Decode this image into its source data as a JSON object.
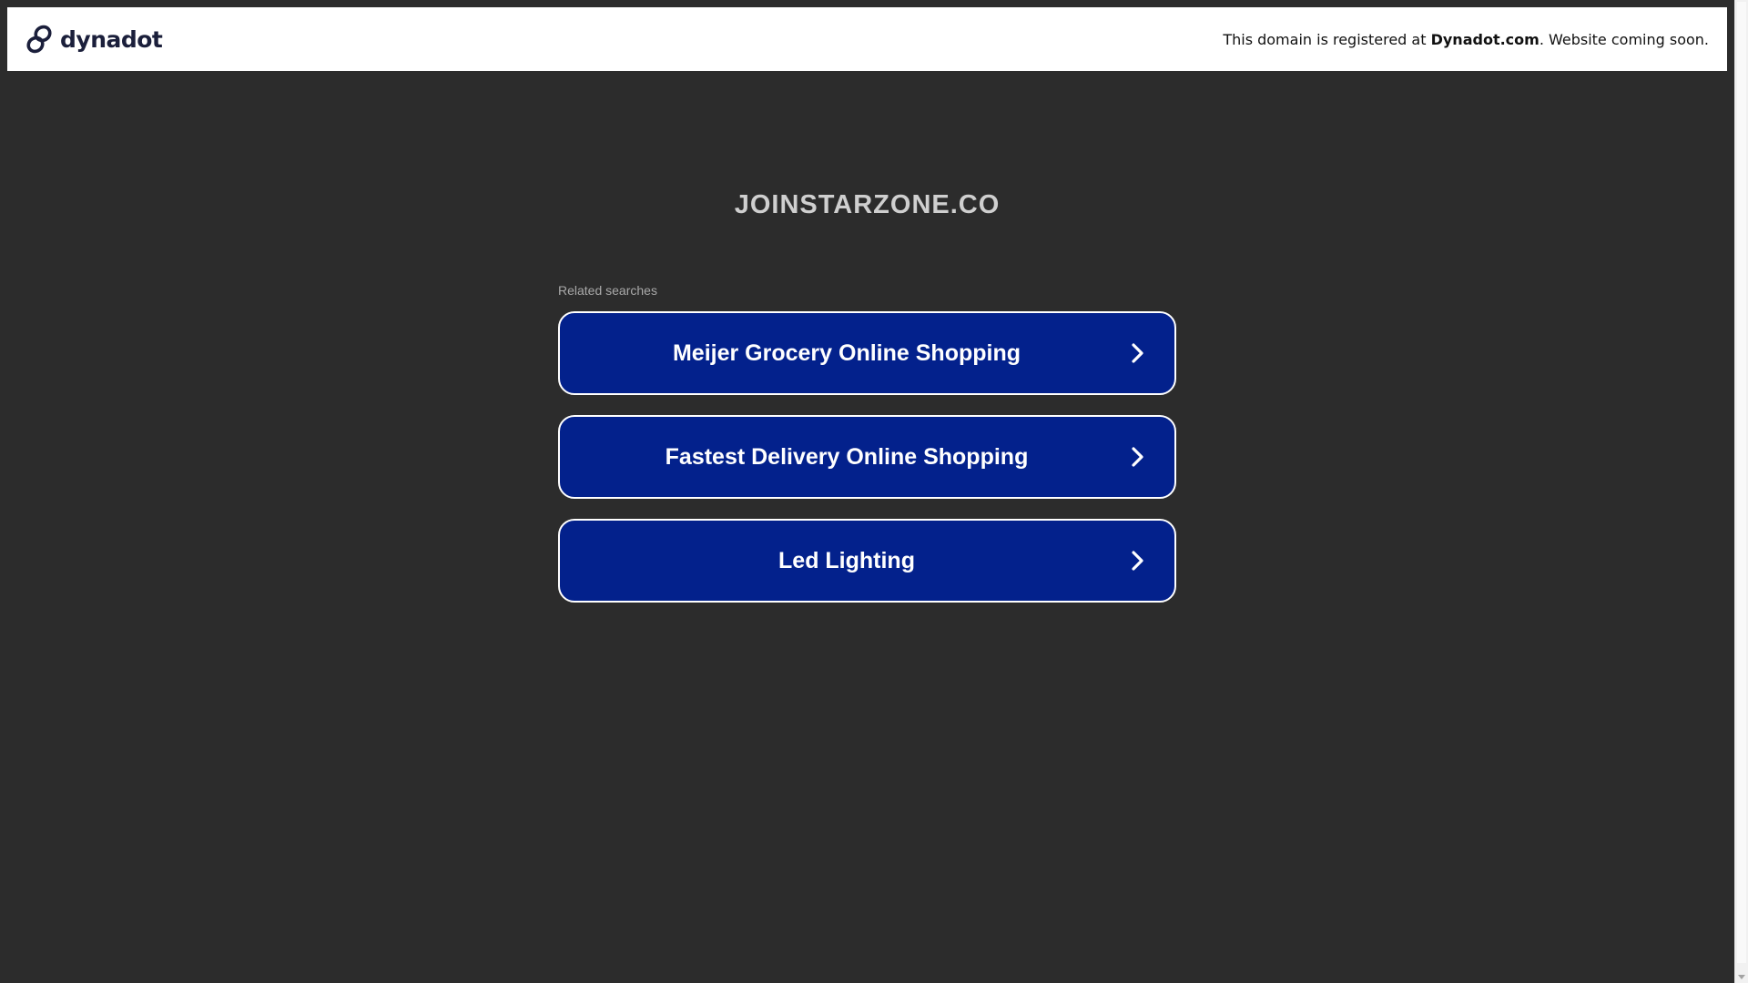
{
  "header": {
    "brand_name": "dynadot",
    "brand_icon": "dynadot-link-icon",
    "notice_prefix": "This domain is registered at ",
    "notice_link": "Dynadot.com",
    "notice_suffix": ". Website coming soon."
  },
  "main": {
    "domain": "JOINSTARZONE.CO",
    "related_label": "Related searches",
    "searches": [
      {
        "label": "Meijer Grocery Online Shopping",
        "icon": "chevron-right-icon"
      },
      {
        "label": "Fastest Delivery Online Shopping",
        "icon": "chevron-right-icon"
      },
      {
        "label": "Led Lighting",
        "icon": "chevron-right-icon"
      }
    ]
  },
  "colors": {
    "background": "#2c2c2c",
    "button_bg": "#03218c",
    "button_border": "#ffffff",
    "brand_text": "#1b1f3b"
  }
}
